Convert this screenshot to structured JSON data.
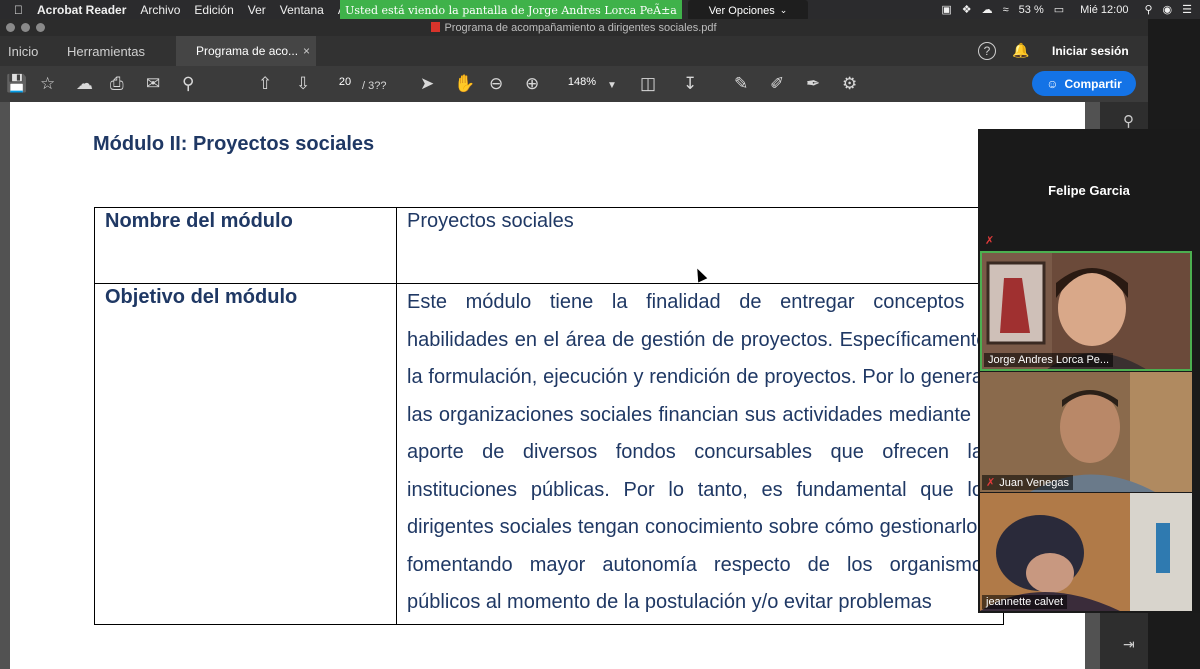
{
  "menubar": {
    "apple_icon": "apple-icon",
    "app_name": "Acrobat Reader",
    "menus": [
      "Archivo",
      "Edición",
      "Ver",
      "Ventana",
      "A"
    ],
    "share_banner": "Usted está viendo la pantalla de Jorge Andres Lorca PeÃ±a",
    "view_options": "Ver Opciones",
    "battery": "53 %",
    "clock": "Mié 12:00"
  },
  "window": {
    "title": "Programa de acompañamiento a dirigentes sociales.pdf"
  },
  "tabs": {
    "home": "Inicio",
    "tools": "Herramientas",
    "doc": "Programa de aco...",
    "close": "×",
    "sign_in": "Iniciar sesión"
  },
  "toolbar": {
    "page_number": "20",
    "page_total": "/ 3??",
    "zoom": "148%",
    "share": "Compartir"
  },
  "document": {
    "heading": "Módulo II: Proyectos sociales",
    "rows": [
      {
        "label": "Nombre del módulo",
        "value": "Proyectos sociales"
      },
      {
        "label": "Objetivo del módulo",
        "value": "Este módulo tiene la finalidad de entregar conceptos y habilidades en el área de gestión de proyectos. Específicamente, la formulación, ejecución y rendición de proyectos. Por lo general, las organizaciones sociales financian sus actividades mediante el aporte de diversos fondos concursables que ofrecen las instituciones públicas. Por lo tanto, es fundamental que los dirigentes sociales tengan conocimiento sobre cómo gestionarlos, fomentando mayor autonomía respecto de los organismos públicos al momento de la postulación y/o evitar problemas"
      }
    ]
  },
  "zoom_panel": {
    "speaker": "Felipe Garcia",
    "participants": [
      {
        "name": "Jorge Andres Lorca Pe...",
        "muted": false
      },
      {
        "name": "Juan Venegas",
        "muted": true
      },
      {
        "name": "jeannette calvet",
        "muted": false
      }
    ]
  },
  "colors": {
    "doc_text": "#1f3864",
    "share_banner": "#3fb24a",
    "share_button": "#1473e6",
    "active_speaker_border": "#4caf50"
  }
}
